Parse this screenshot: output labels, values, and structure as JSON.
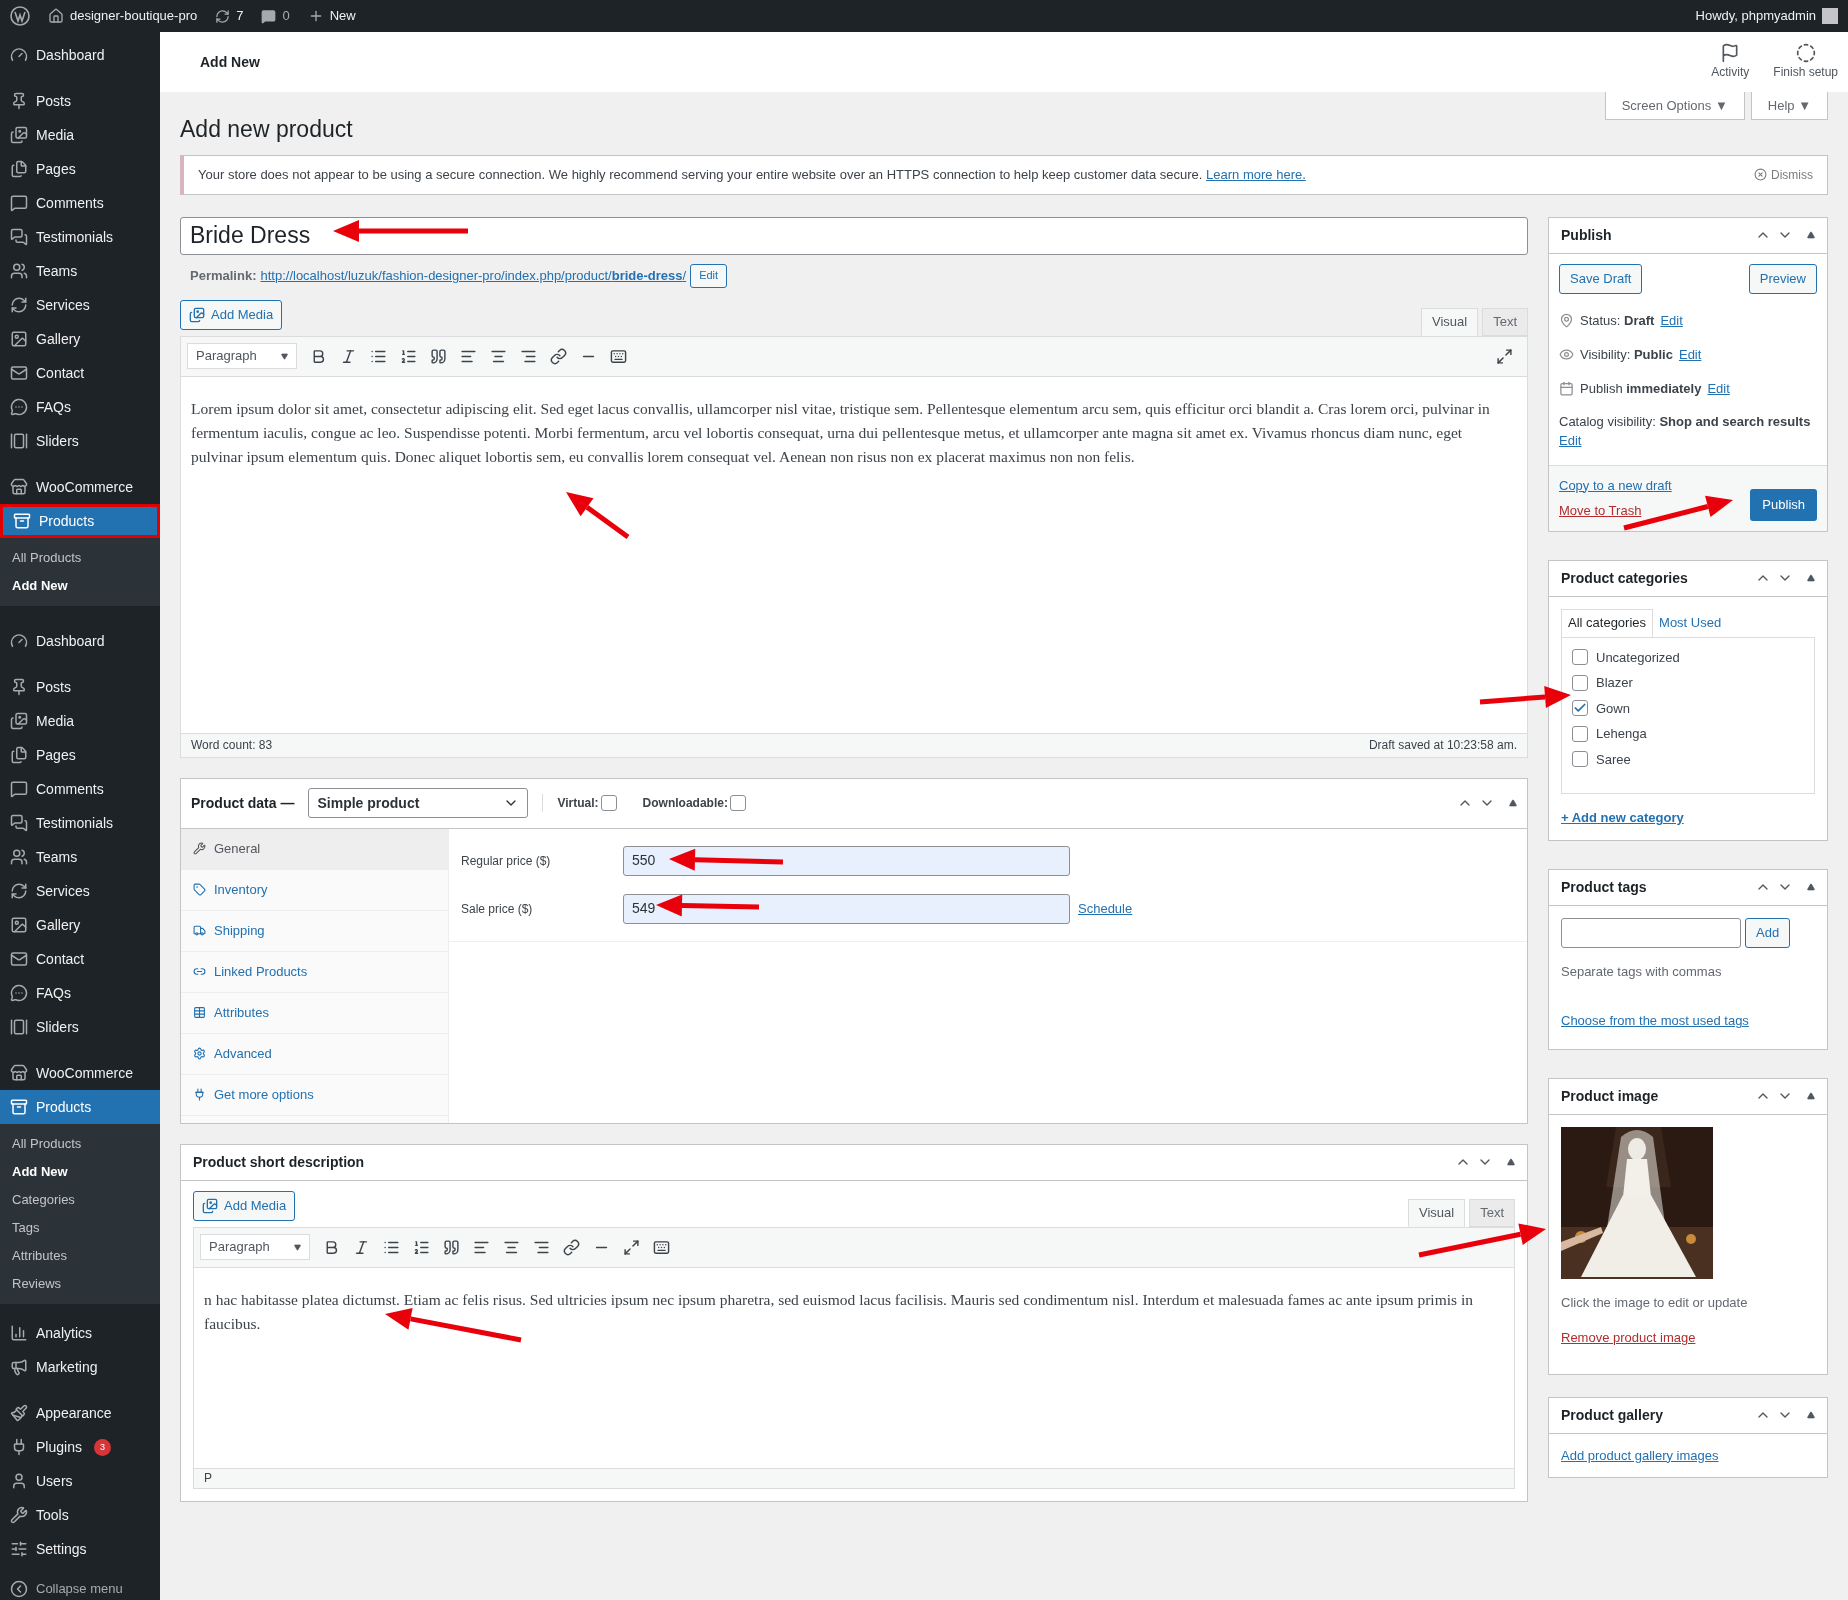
{
  "admin_bar": {
    "site": "designer-boutique-pro",
    "updates": "7",
    "comments": "0",
    "new": "New",
    "greeting": "Howdy, phpmyadmin"
  },
  "sidebar": {
    "menus": [
      {
        "groups": [
          [
            {
              "label": "Dashboard",
              "selected": false
            }
          ],
          [
            {
              "label": "Posts",
              "selected": false
            },
            {
              "label": "Media",
              "selected": false
            },
            {
              "label": "Pages",
              "selected": false
            },
            {
              "label": "Comments",
              "selected": false
            },
            {
              "label": "Testimonials",
              "selected": false
            },
            {
              "label": "Teams",
              "selected": false
            },
            {
              "label": "Services",
              "selected": false
            },
            {
              "label": "Gallery",
              "selected": false
            },
            {
              "label": "Contact",
              "selected": false
            },
            {
              "label": "FAQs",
              "selected": false
            },
            {
              "label": "Sliders",
              "selected": false
            }
          ],
          [
            {
              "label": "WooCommerce",
              "selected": false
            },
            {
              "label": "Products",
              "selected": true,
              "highlighted": true,
              "children": [
                {
                  "label": "All Products",
                  "selected": false
                },
                {
                  "label": "Add New",
                  "selected": true
                }
              ]
            }
          ]
        ]
      },
      {
        "groups": [
          [
            {
              "label": "Dashboard",
              "selected": false
            }
          ],
          [
            {
              "label": "Posts",
              "selected": false
            },
            {
              "label": "Media",
              "selected": false
            },
            {
              "label": "Pages",
              "selected": false
            },
            {
              "label": "Comments",
              "selected": false
            },
            {
              "label": "Testimonials",
              "selected": false
            },
            {
              "label": "Teams",
              "selected": false
            },
            {
              "label": "Services",
              "selected": false
            },
            {
              "label": "Gallery",
              "selected": false
            },
            {
              "label": "Contact",
              "selected": false
            },
            {
              "label": "FAQs",
              "selected": false
            },
            {
              "label": "Sliders",
              "selected": false
            }
          ],
          [
            {
              "label": "WooCommerce",
              "selected": false
            },
            {
              "label": "Products",
              "selected": true,
              "highlighted": false,
              "children": [
                {
                  "label": "All Products",
                  "selected": false
                },
                {
                  "label": "Add New",
                  "selected": true
                },
                {
                  "label": "Categories",
                  "selected": false
                },
                {
                  "label": "Tags",
                  "selected": false
                },
                {
                  "label": "Attributes",
                  "selected": false
                },
                {
                  "label": "Reviews",
                  "selected": false
                }
              ]
            }
          ],
          [
            {
              "label": "Analytics",
              "selected": false
            },
            {
              "label": "Marketing",
              "selected": false
            }
          ],
          [
            {
              "label": "Appearance",
              "selected": false
            },
            {
              "label": "Plugins",
              "selected": false,
              "badge": "3"
            },
            {
              "label": "Users",
              "selected": false
            },
            {
              "label": "Tools",
              "selected": false
            },
            {
              "label": "Settings",
              "selected": false
            }
          ]
        ],
        "collapse": "Collapse menu"
      }
    ]
  },
  "header": {
    "title": "Add New",
    "actions": [
      "Activity",
      "Finish setup"
    ]
  },
  "screen_tabs": [
    "Screen Options ▼",
    "Help ▼"
  ],
  "page_title": "Add new product",
  "notice": {
    "text": "Your store does not appear to be using a secure connection. We highly recommend serving your entire website over an HTTPS connection to help keep customer data secure.",
    "link": "Learn more here.",
    "dismiss": "Dismiss"
  },
  "title_field": {
    "value": "Bride Dress"
  },
  "permalink": {
    "label": "Permalink:",
    "url": "http://localhost/luzuk/fashion-designer-pro/index.php/product/**bride-dress**/",
    "edit": "Edit"
  },
  "editor": {
    "add_media": "Add Media",
    "tabs": [
      {
        "label": "Visual",
        "selected": true
      },
      {
        "label": "Text",
        "selected": false
      }
    ],
    "format": "Paragraph",
    "content": "Lorem ipsum dolor sit amet, consectetur adipiscing elit. Sed eget lacus convallis, ullamcorper nisl vitae, tristique sem. Pellentesque elementum arcu sem, quis efficitur orci blandit a. Cras lorem orci, pulvinar in fermentum iaculis, congue ac leo. Suspendisse potenti. Morbi fermentum, arcu vel lobortis consequat, urna dui pellentesque metus, et ullamcorper ante magna sit amet ex. Vivamus rhoncus diam nunc, eget pulvinar ipsum elementum quis. Donec aliquet lobortis sem, eu convallis lorem consequat vel. Aenean non risus non ex placerat maximus non non felis.",
    "word_count": "Word count: 83",
    "saved": "Draft saved at 10:23:58 am."
  },
  "product_data": {
    "title": "Product data —",
    "type": "Simple product",
    "virtual": {
      "label": "Virtual:",
      "checked": false
    },
    "downloadable": {
      "label": "Downloadable:",
      "checked": false
    },
    "tabs": [
      {
        "label": "General",
        "selected": true
      },
      {
        "label": "Inventory",
        "selected": false
      },
      {
        "label": "Shipping",
        "selected": false
      },
      {
        "label": "Linked Products",
        "selected": false
      },
      {
        "label": "Attributes",
        "selected": false
      },
      {
        "label": "Advanced",
        "selected": false
      },
      {
        "label": "Get more options",
        "selected": false
      }
    ],
    "fields": [
      {
        "label": "Regular price ($)",
        "value": "550"
      },
      {
        "label": "Sale price ($)",
        "value": "549",
        "link": "Schedule"
      }
    ]
  },
  "short_description": {
    "title": "Product short description",
    "add_media": "Add Media",
    "tabs": [
      {
        "label": "Visual",
        "selected": true
      },
      {
        "label": "Text",
        "selected": false
      }
    ],
    "format": "Paragraph",
    "content": "n hac habitasse platea dictumst. Etiam ac felis risus. Sed ultricies ipsum nec ipsum pharetra, sed euismod lacus facilisis. Mauris sed condimentum nisl. Interdum et malesuada fames ac ante ipsum primis in faucibus.",
    "path": "P"
  },
  "publish": {
    "title": "Publish",
    "save_draft": "Save Draft",
    "preview": "Preview",
    "rows": [
      {
        "text": "Status: **Draft**",
        "edit": "Edit"
      },
      {
        "text": "Visibility: **Public**",
        "edit": "Edit"
      },
      {
        "text": "Publish **immediately**",
        "edit": "Edit"
      }
    ],
    "catalog": {
      "text": "Catalog visibility: **Shop and search results**",
      "edit": "Edit"
    },
    "copy": "Copy to a new draft",
    "trash": "Move to Trash",
    "publish": "Publish"
  },
  "categories": {
    "title": "Product categories",
    "tabs": [
      {
        "label": "All categories",
        "selected": true
      },
      {
        "label": "Most Used",
        "selected": false
      }
    ],
    "items": [
      {
        "label": "Uncategorized",
        "checked": false
      },
      {
        "label": "Blazer",
        "checked": false
      },
      {
        "label": "Gown",
        "checked": true
      },
      {
        "label": "Lehenga",
        "checked": false
      },
      {
        "label": "Saree",
        "checked": false
      }
    ],
    "add": "+ Add new category"
  },
  "tags": {
    "title": "Product tags",
    "add": "Add",
    "hint": "Separate tags with commas",
    "choose": "Choose from the most used tags"
  },
  "image": {
    "title": "Product image",
    "hint": "Click the image to edit or update",
    "remove": "Remove product image"
  },
  "gallery": {
    "title": "Product gallery",
    "add": "Add product gallery images"
  }
}
